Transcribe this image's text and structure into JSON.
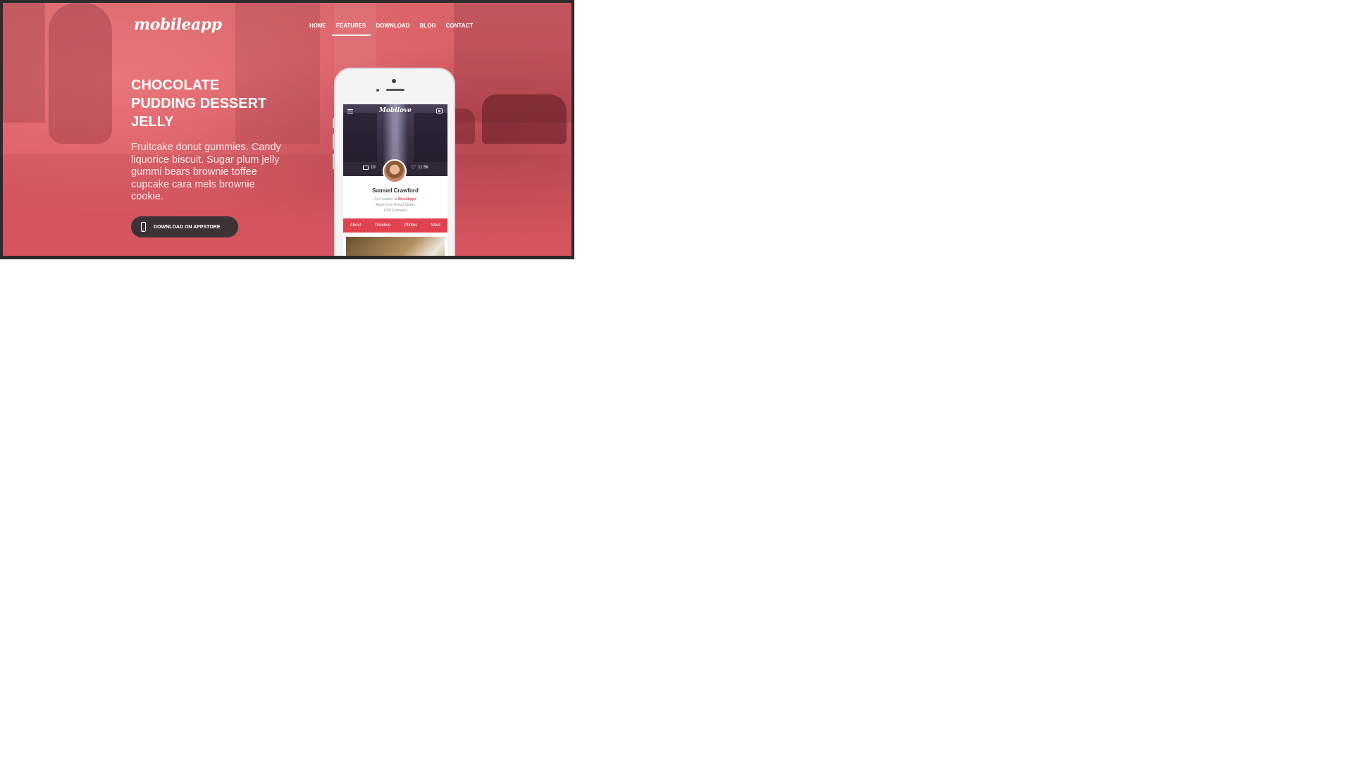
{
  "site": {
    "logo": "mobileapp",
    "nav": [
      {
        "label": "HOME",
        "active": false
      },
      {
        "label": "FEATURES",
        "active": true
      },
      {
        "label": "DOWNLOAD",
        "active": false
      },
      {
        "label": "BLOG",
        "active": false
      },
      {
        "label": "CONTACT",
        "active": false
      }
    ]
  },
  "hero": {
    "headline_lines": [
      "CHOCOLATE",
      "PUDDING DESSERT",
      "JELLY"
    ],
    "subtext": "Fruitcake donut gummies. Candy liquorice biscuit. Sugar plum jelly gummi bears brownie toffee cupcake cara mels brownie cookie.",
    "cta_label": "DOWNLOAD ON APPSTORE",
    "accent_color": "#dc5c64",
    "button_color": "#3d3336"
  },
  "phone_app": {
    "title": "Mobilove",
    "photos_count": "19",
    "likes_count": "11.5K",
    "profile_name": "Samuel Crawford",
    "role_prefix": "Co-Founder at",
    "role_company": "StockApps",
    "location": "Made from United States",
    "followers": "1658 Followers",
    "tabs": [
      "About",
      "Timeline",
      "Photos",
      "Stats"
    ],
    "tab_color": "#e0434f"
  },
  "icons": {
    "cta": "phone-icon",
    "app_menu": "menu-icon",
    "app_camera": "camera-icon",
    "photos": "image-icon",
    "likes": "heart-icon"
  }
}
